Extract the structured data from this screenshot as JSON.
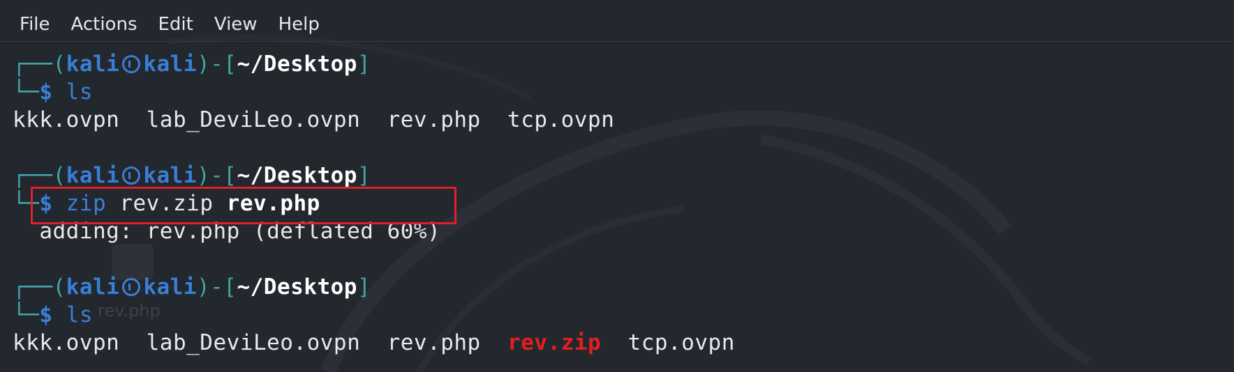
{
  "menu": {
    "items": [
      "File",
      "Actions",
      "Edit",
      "View",
      "Help"
    ]
  },
  "prompt": {
    "open": "┌──(",
    "user": "kali",
    "host": "kali",
    "mid": ")-[",
    "dir": "~/Desktop",
    "close": "]",
    "corner": "└─",
    "dollar": "$"
  },
  "terminal": {
    "cmd1": "ls",
    "out1": "kkk.ovpn  lab_DeviLeo.ovpn  rev.php  tcp.ovpn",
    "cmd2_name": "zip",
    "cmd2_arg1": "rev.zip",
    "cmd2_arg2": "rev.php",
    "out2": "  adding: rev.php (deflated 60%)",
    "cmd3": "ls",
    "out3_a": "kkk.ovpn  lab_DeviLeo.ovpn  rev.php  ",
    "out3_red": "rev.zip",
    "out3_b": "  tcp.ovpn"
  },
  "desktop": {
    "ghost_label": "rev.php"
  },
  "colors": {
    "background": "#23272e",
    "prompt_blue": "#3a7fd6",
    "frame_teal": "#3fa6a8",
    "highlight_red": "#e0202a",
    "archive_red": "#e41e1e"
  }
}
